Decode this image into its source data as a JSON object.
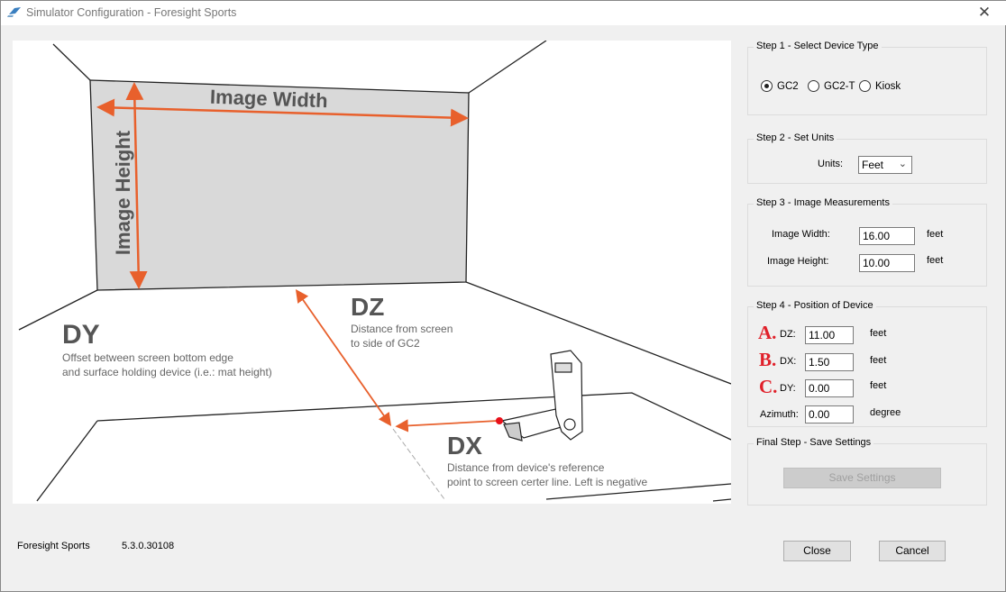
{
  "window": {
    "title": "Simulator Configuration - Foresight Sports",
    "close_icon": "close-icon"
  },
  "diagram": {
    "image_width_label": "Image Width",
    "image_height_label": "Image Height",
    "dy": {
      "title": "DY",
      "line1": "Offset between screen bottom edge",
      "line2": "and surface holding device (i.e.: mat height)"
    },
    "dz": {
      "title": "DZ",
      "line1": "Distance from screen",
      "line2": "to side of GC2"
    },
    "dx": {
      "title": "DX",
      "line1": "Distance from device's reference",
      "line2": "point to screen certer line. Left is negative"
    },
    "accent": "#e8602c"
  },
  "step1": {
    "legend": "Step 1  - Select Device Type",
    "options": [
      {
        "label": "GC2",
        "selected": true
      },
      {
        "label": "GC2-T",
        "selected": false
      },
      {
        "label": "Kiosk",
        "selected": false
      }
    ]
  },
  "step2": {
    "legend": "Step 2 - Set Units",
    "units_label": "Units:",
    "units_value": "Feet"
  },
  "step3": {
    "legend": "Step 3 - Image Measurements",
    "width_label": "Image Width:",
    "width_value": "16.00",
    "height_label": "Image Height:",
    "height_value": "10.00",
    "unit": "feet"
  },
  "step4": {
    "legend": "Step 4 - Position of Device",
    "dz": {
      "letter": "A.",
      "label": "DZ:",
      "value": "11.00",
      "unit": "feet"
    },
    "dx": {
      "letter": "B.",
      "label": "DX:",
      "value": "1.50",
      "unit": "feet"
    },
    "dy": {
      "letter": "C.",
      "label": "DY:",
      "value": "0.00",
      "unit": "feet"
    },
    "azimuth": {
      "label": "Azimuth:",
      "value": "0.00",
      "unit": "degree"
    }
  },
  "final": {
    "legend": "Final Step - Save Settings",
    "save_label": "Save Settings"
  },
  "footer": {
    "company": "Foresight Sports",
    "version": "5.3.0.30108",
    "close_label": "Close",
    "cancel_label": "Cancel"
  }
}
